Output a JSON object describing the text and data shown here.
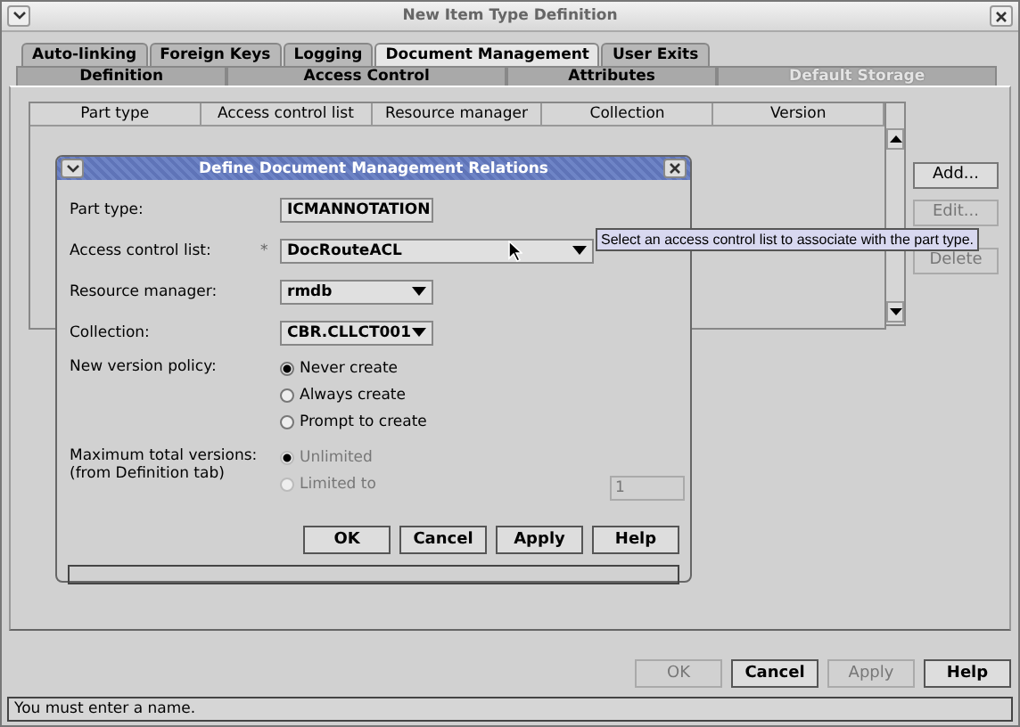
{
  "window": {
    "title": "New Item Type Definition"
  },
  "tabs_row_1": [
    {
      "label": "Auto-linking",
      "selected": false
    },
    {
      "label": "Foreign Keys",
      "selected": false
    },
    {
      "label": "Logging",
      "selected": false
    },
    {
      "label": "Document Management",
      "selected": true
    },
    {
      "label": "User Exits",
      "selected": false
    }
  ],
  "tabs_row_2": [
    {
      "label": "Definition",
      "disabled": false
    },
    {
      "label": "Access Control",
      "disabled": false
    },
    {
      "label": "Attributes",
      "disabled": false
    },
    {
      "label": "Default Storage",
      "disabled": true
    }
  ],
  "table": {
    "columns": [
      "Part type",
      "Access control list",
      "Resource manager",
      "Collection",
      "Version"
    ]
  },
  "side_buttons": [
    {
      "label": "Add...",
      "disabled": false
    },
    {
      "label": "Edit...",
      "disabled": true
    },
    {
      "label": "Delete",
      "disabled": true
    }
  ],
  "dialog": {
    "title": "Define Document Management Relations",
    "fields": [
      {
        "label": "Part type:",
        "value": "ICMANNOTATION",
        "kind": "short"
      },
      {
        "label": "Access control list:",
        "marker": "*",
        "value": "DocRouteACL",
        "kind": "wide"
      },
      {
        "label": "Resource manager:",
        "value": "rmdb",
        "kind": "short"
      },
      {
        "label": "Collection:",
        "value": "CBR.CLLCT001",
        "kind": "short"
      }
    ],
    "version_policy": {
      "label": "New version policy:",
      "options": [
        {
          "label": "Never create",
          "selected": true
        },
        {
          "label": "Always create",
          "selected": false
        },
        {
          "label": "Prompt to create",
          "selected": false
        }
      ]
    },
    "max_versions": {
      "label_lines": [
        "Maximum total versions:",
        "(from Definition tab)"
      ],
      "disabled": true,
      "options": [
        {
          "label": "Unlimited",
          "selected": true
        },
        {
          "label": "Limited to",
          "selected": false
        }
      ],
      "limit_value": "1"
    },
    "buttons": [
      "OK",
      "Cancel",
      "Apply",
      "Help"
    ]
  },
  "tooltip": "Select an access control list to associate with the part type.",
  "buttons": [
    {
      "label": "OK",
      "disabled": true
    },
    {
      "label": "Cancel",
      "disabled": false
    },
    {
      "label": "Apply",
      "disabled": true
    },
    {
      "label": "Help",
      "disabled": false
    }
  ],
  "status_bar": "You must enter a name."
}
